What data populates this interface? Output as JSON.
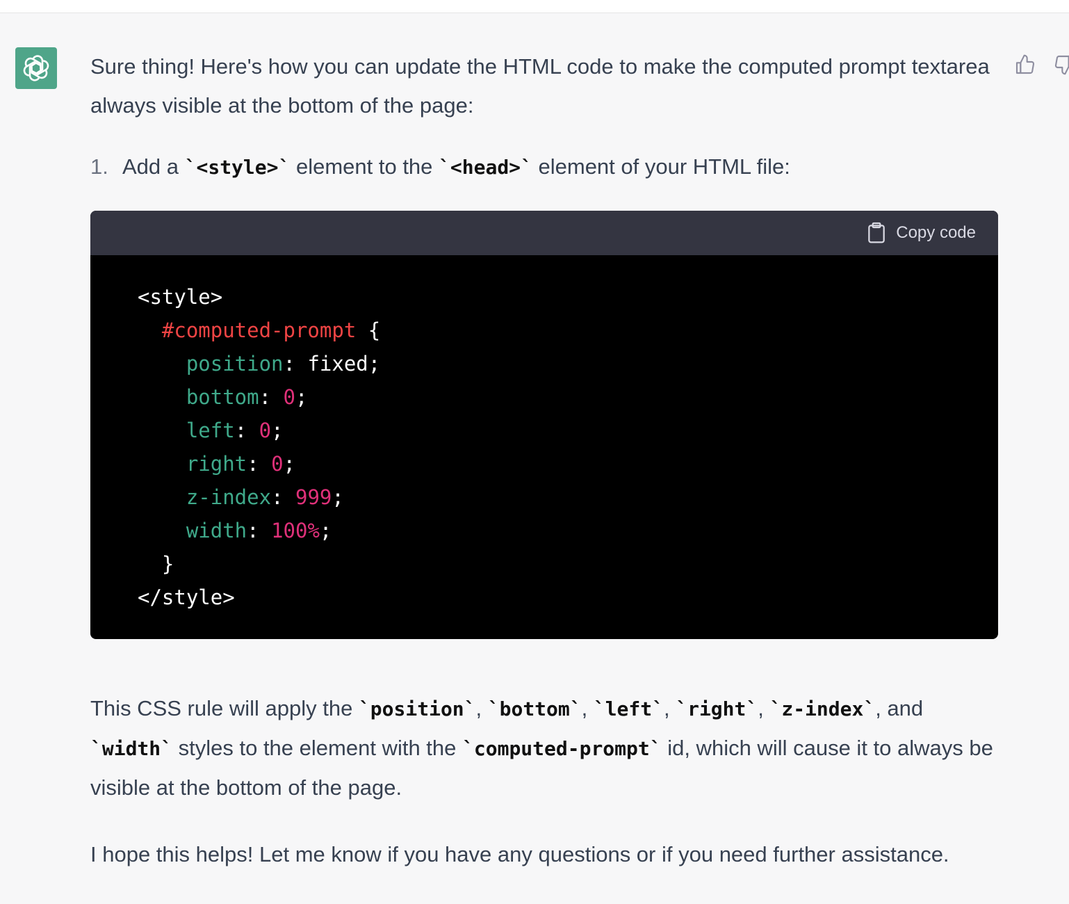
{
  "message": {
    "intro": "Sure thing! Here's how you can update the HTML code to make the computed prompt textarea always visible at the bottom of the page:",
    "step": {
      "number": "1.",
      "text_a": "Add a ",
      "code_a": "`<style>`",
      "text_b": " element to the ",
      "code_b": "`<head>`",
      "text_c": " element of your HTML file:"
    },
    "code_block": {
      "copy_label": "Copy code",
      "lines": {
        "l1": "<style>",
        "l2_sel": "#computed-prompt",
        "l2_rest": " {",
        "l3_prop": "position",
        "l3_rest": ": fixed;",
        "l4_prop": "bottom",
        "l4_colon": ": ",
        "l4_val": "0",
        "l4_end": ";",
        "l5_prop": "left",
        "l5_colon": ": ",
        "l5_val": "0",
        "l5_end": ";",
        "l6_prop": "right",
        "l6_colon": ": ",
        "l6_val": "0",
        "l6_end": ";",
        "l7_prop": "z-index",
        "l7_colon": ": ",
        "l7_val": "999",
        "l7_end": ";",
        "l8_prop": "width",
        "l8_colon": ": ",
        "l8_val": "100%",
        "l8_end": ";",
        "l9": "}",
        "l10": "</style>"
      }
    },
    "explanation": {
      "t1": "This CSS rule will apply the ",
      "c1": "`position`",
      "s1": ", ",
      "c2": "`bottom`",
      "s2": ", ",
      "c3": "`left`",
      "s3": ", ",
      "c4": "`right`",
      "s4": ", ",
      "c5": "`z-index`",
      "s5": ", and ",
      "c6": "`width`",
      "t2": " styles to the element with the ",
      "c7": "`computed-prompt`",
      "t3": " id, which will cause it to always be visible at the bottom of the page."
    },
    "closing": "I hope this helps! Let me know if you have any questions or if you need further assistance."
  },
  "icons": {
    "avatar": "openai-logo-icon",
    "like": "thumbs-up-icon",
    "dislike": "thumbs-down-icon",
    "copy": "clipboard-icon"
  },
  "colors": {
    "avatar_bg": "#4fa589",
    "code_header_bg": "#343541",
    "code_bg": "#000000",
    "selector": "#ef4444",
    "property": "#3fa98a",
    "number": "#df3079"
  }
}
